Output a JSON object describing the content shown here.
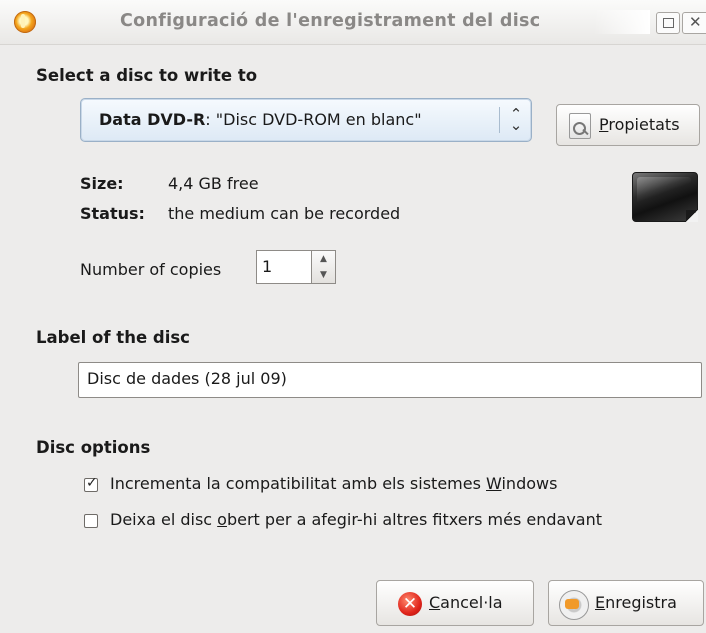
{
  "window": {
    "title": "Configuració de l'enregistrament del disc"
  },
  "disc_select": {
    "heading": "Select a disc to write to",
    "combo_bold": "Data DVD-R",
    "combo_rest": ": \"Disc DVD-ROM en blanc\"",
    "properties_button_mnemonic": "P",
    "properties_button_rest": "ropietats"
  },
  "disc_info": {
    "size_label": "Size:",
    "size_value": "4,4 GB free",
    "status_label": "Status:",
    "status_value": "the medium can be recorded"
  },
  "copies": {
    "label": "Number of copies",
    "value": "1"
  },
  "disc_label": {
    "heading": "Label of the disc",
    "value": "Disc de dades (28 jul 09)"
  },
  "options": {
    "heading": "Disc options",
    "items": [
      {
        "checked": true,
        "text_before": "Incrementa la compatibilitat amb els sistemes ",
        "mnemonic": "W",
        "text_after": "indows"
      },
      {
        "checked": false,
        "text_before": "Deixa el disc ",
        "mnemonic": "o",
        "text_after": "bert per a afegir-hi altres fitxers més endavant"
      }
    ]
  },
  "actions": {
    "cancel_mnemonic": "C",
    "cancel_rest": "ancel·la",
    "save_mnemonic": "E",
    "save_rest": "nregistra"
  }
}
